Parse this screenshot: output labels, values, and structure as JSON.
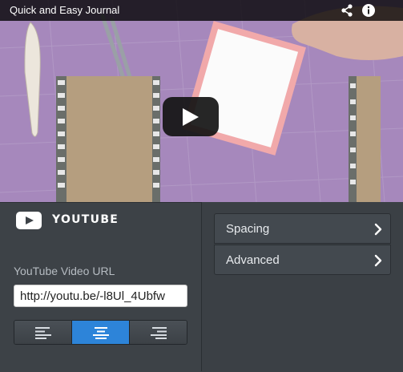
{
  "video": {
    "title": "Quick and Easy Journal",
    "icons": {
      "share": "share-icon",
      "info": "info-icon",
      "play": "play-icon"
    }
  },
  "widget": {
    "logo_icon": "youtube-icon",
    "title": "YOUTUBE",
    "url_label": "YouTube Video URL",
    "url_value": "http://youtu.be/-l8Ul_4Ubfw",
    "alignment": {
      "options": [
        "left",
        "center",
        "right"
      ],
      "selected": "center",
      "icons": [
        "align-left-icon",
        "align-center-icon",
        "align-right-icon"
      ]
    }
  },
  "menu": {
    "items": [
      {
        "label": "Spacing",
        "icon": "chevron-right-icon"
      },
      {
        "label": "Advanced",
        "icon": "chevron-right-icon"
      }
    ]
  },
  "colors": {
    "accent": "#2d84d9",
    "panel_bg": "#3d4247",
    "video_bg": "#a587bb"
  }
}
